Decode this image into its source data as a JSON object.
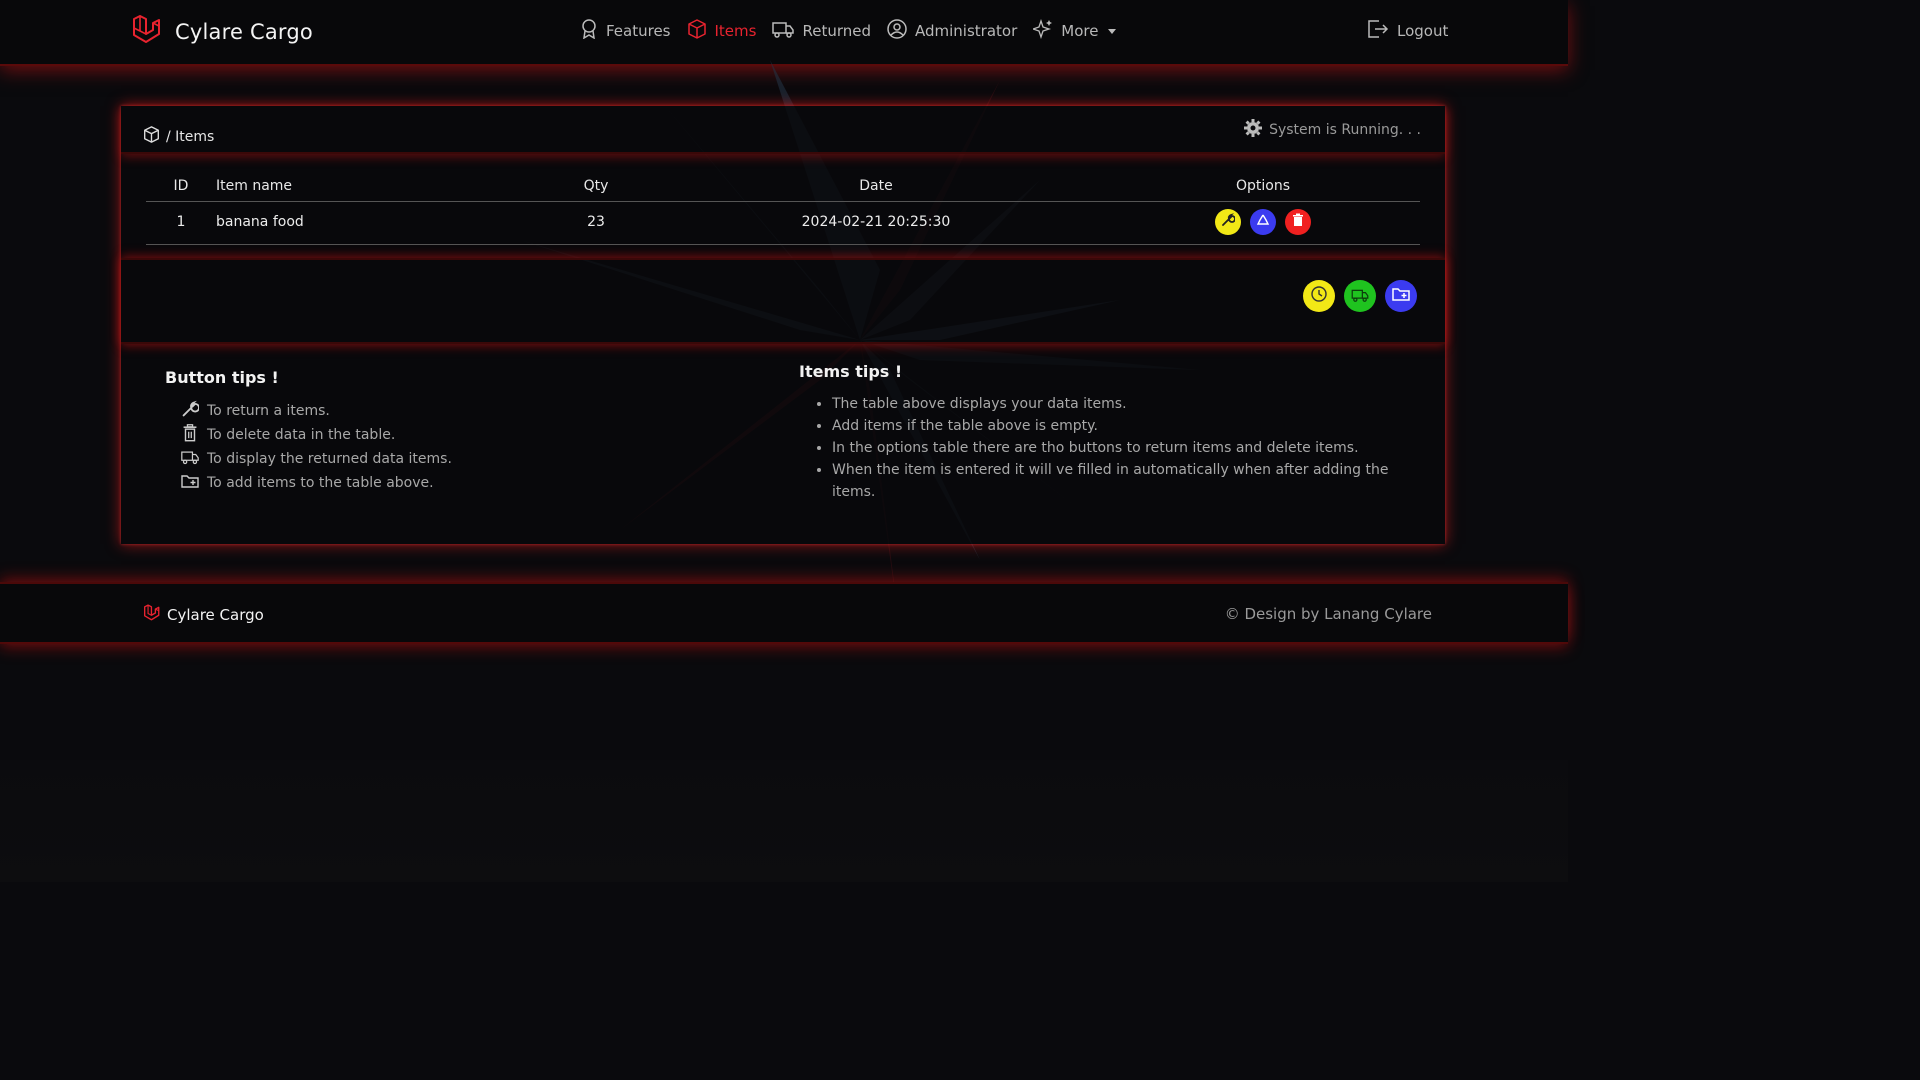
{
  "brand": {
    "name": "Cylare Cargo"
  },
  "nav": {
    "items": [
      {
        "label": "Features",
        "icon": "award-icon"
      },
      {
        "label": "Items",
        "icon": "box-icon",
        "active": true
      },
      {
        "label": "Returned",
        "icon": "truck-icon"
      },
      {
        "label": "Administrator",
        "icon": "user-circle-icon"
      },
      {
        "label": "More",
        "icon": "sparkle-icon"
      }
    ],
    "logout": "Logout"
  },
  "card": {
    "breadcrumb": "/ Items",
    "status": "System is Running. . ."
  },
  "table": {
    "headers": {
      "id": "ID",
      "name": "Item name",
      "qty": "Qty",
      "date": "Date",
      "options": "Options"
    },
    "rows": [
      {
        "id": "1",
        "name": "banana food",
        "qty": "23",
        "date": "2024-02-21 20:25:30"
      }
    ]
  },
  "button_tips": {
    "title": "Button tips !",
    "items": [
      {
        "icon": "wrench-icon",
        "text": "To return a items."
      },
      {
        "icon": "trash-icon",
        "text": "To delete data in the table."
      },
      {
        "icon": "truck-icon",
        "text": "To display the returned data items."
      },
      {
        "icon": "folder-plus-icon",
        "text": "To add items to the table above."
      }
    ]
  },
  "items_tips": {
    "title": "Items tips !",
    "items": [
      "The table above displays your data items.",
      "Add items if the table above is empty.",
      "In the options table there are tho buttons to return items and delete items.",
      "When the item is entered it will ve filled in automatically when after adding the items."
    ]
  },
  "footer": {
    "brand": "Cylare Cargo",
    "credit": "© Design by Lanang Cylare"
  },
  "colors": {
    "accent": "#e8232f",
    "yellow_btn": "#f2e816",
    "blue_btn": "#3b3bf0",
    "red_btn": "#f02020",
    "green_btn": "#1fc31f"
  }
}
